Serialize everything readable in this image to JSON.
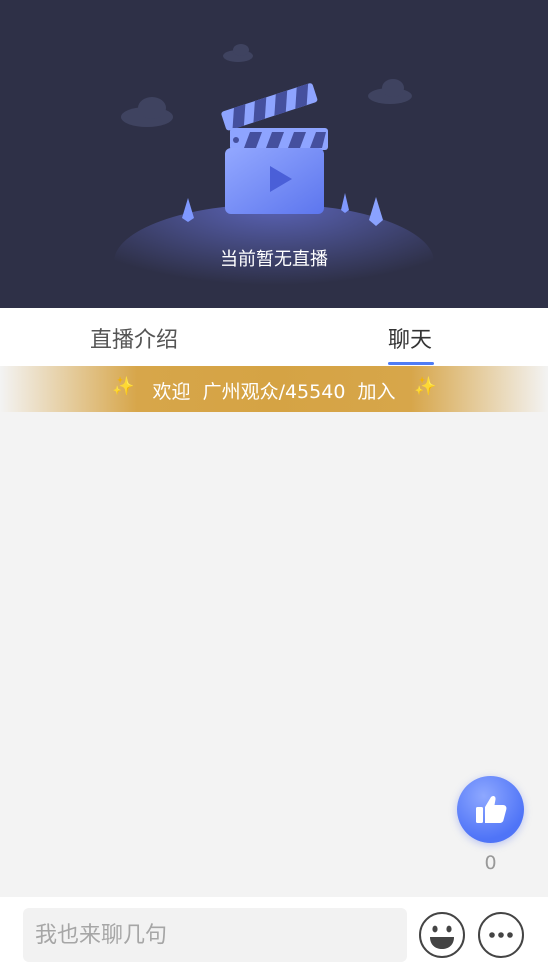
{
  "player": {
    "empty_text": "当前暂无直播",
    "illustration": "clapperboard-icon",
    "colors": {
      "background": "#2e3047",
      "accent": "#6f86f6"
    }
  },
  "tabs": [
    {
      "label": "直播介绍",
      "active": false
    },
    {
      "label": "聊天",
      "active": true
    }
  ],
  "welcome_banner": {
    "text": "欢迎  广州观众/45540  加入",
    "icon": "sparkle-icon",
    "color": "#d5a344"
  },
  "like": {
    "icon": "thumbs-up-icon",
    "count": "0",
    "color": "#5278f7"
  },
  "input_bar": {
    "placeholder": "我也来聊几句",
    "value": "",
    "emoji_icon": "emoji-icon",
    "more_icon": "more-icon"
  }
}
